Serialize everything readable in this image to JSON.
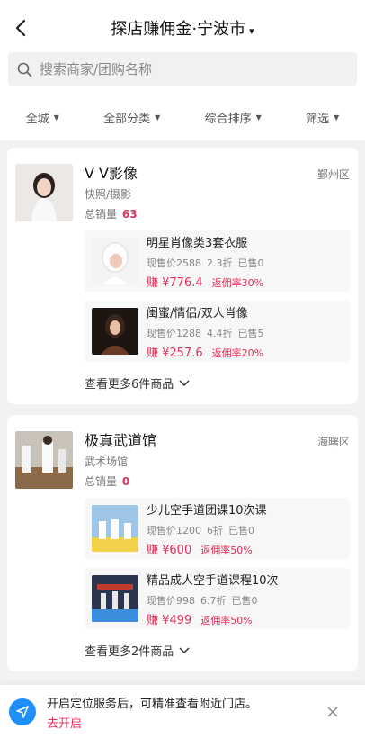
{
  "header": {
    "title": "探店赚佣金·宁波市",
    "title_caret": "▾"
  },
  "search": {
    "placeholder": "搜索商家/团购名称"
  },
  "filters": [
    {
      "label": "全城"
    },
    {
      "label": "全部分类"
    },
    {
      "label": "综合排序"
    },
    {
      "label": "筛选"
    }
  ],
  "shops": [
    {
      "name": "V V影像",
      "category": "快照/摄影",
      "sales_label": "总销量",
      "sales": "63",
      "district": "鄞州区",
      "deals": [
        {
          "title": "明星肖像类3套衣服",
          "price": "现售价2588",
          "discount": "2.3折",
          "sold": "已售0",
          "earn": "赚 ¥776.4",
          "rate": "返佣率30%"
        },
        {
          "title": "闺蜜/情侣/双人肖像",
          "price": "现售价1288",
          "discount": "4.4折",
          "sold": "已售5",
          "earn": "赚 ¥257.6",
          "rate": "返佣率20%"
        }
      ],
      "more": "查看更多6件商品"
    },
    {
      "name": "极真武道馆",
      "category": "武术场馆",
      "sales_label": "总销量",
      "sales": "0",
      "district": "海曙区",
      "deals": [
        {
          "title": "少儿空手道团课10次课",
          "price": "现售价1200",
          "discount": "6折",
          "sold": "已售0",
          "earn": "赚 ¥600",
          "rate": "返佣率50%"
        },
        {
          "title": "精品成人空手道课程10次",
          "price": "现售价998",
          "discount": "6.7折",
          "sold": "已售0",
          "earn": "赚 ¥499",
          "rate": "返佣率50%"
        }
      ],
      "more": "查看更多2件商品"
    }
  ],
  "location_banner": {
    "message": "开启定位服务后，可精准查看附近门店。",
    "action": "去开启"
  },
  "colors": {
    "accent": "#e5305a",
    "location_icon": "#1f8ffb"
  },
  "icons": [
    "back-arrow-icon",
    "search-icon",
    "chevron-down-icon",
    "location-arrow-icon",
    "close-icon"
  ]
}
